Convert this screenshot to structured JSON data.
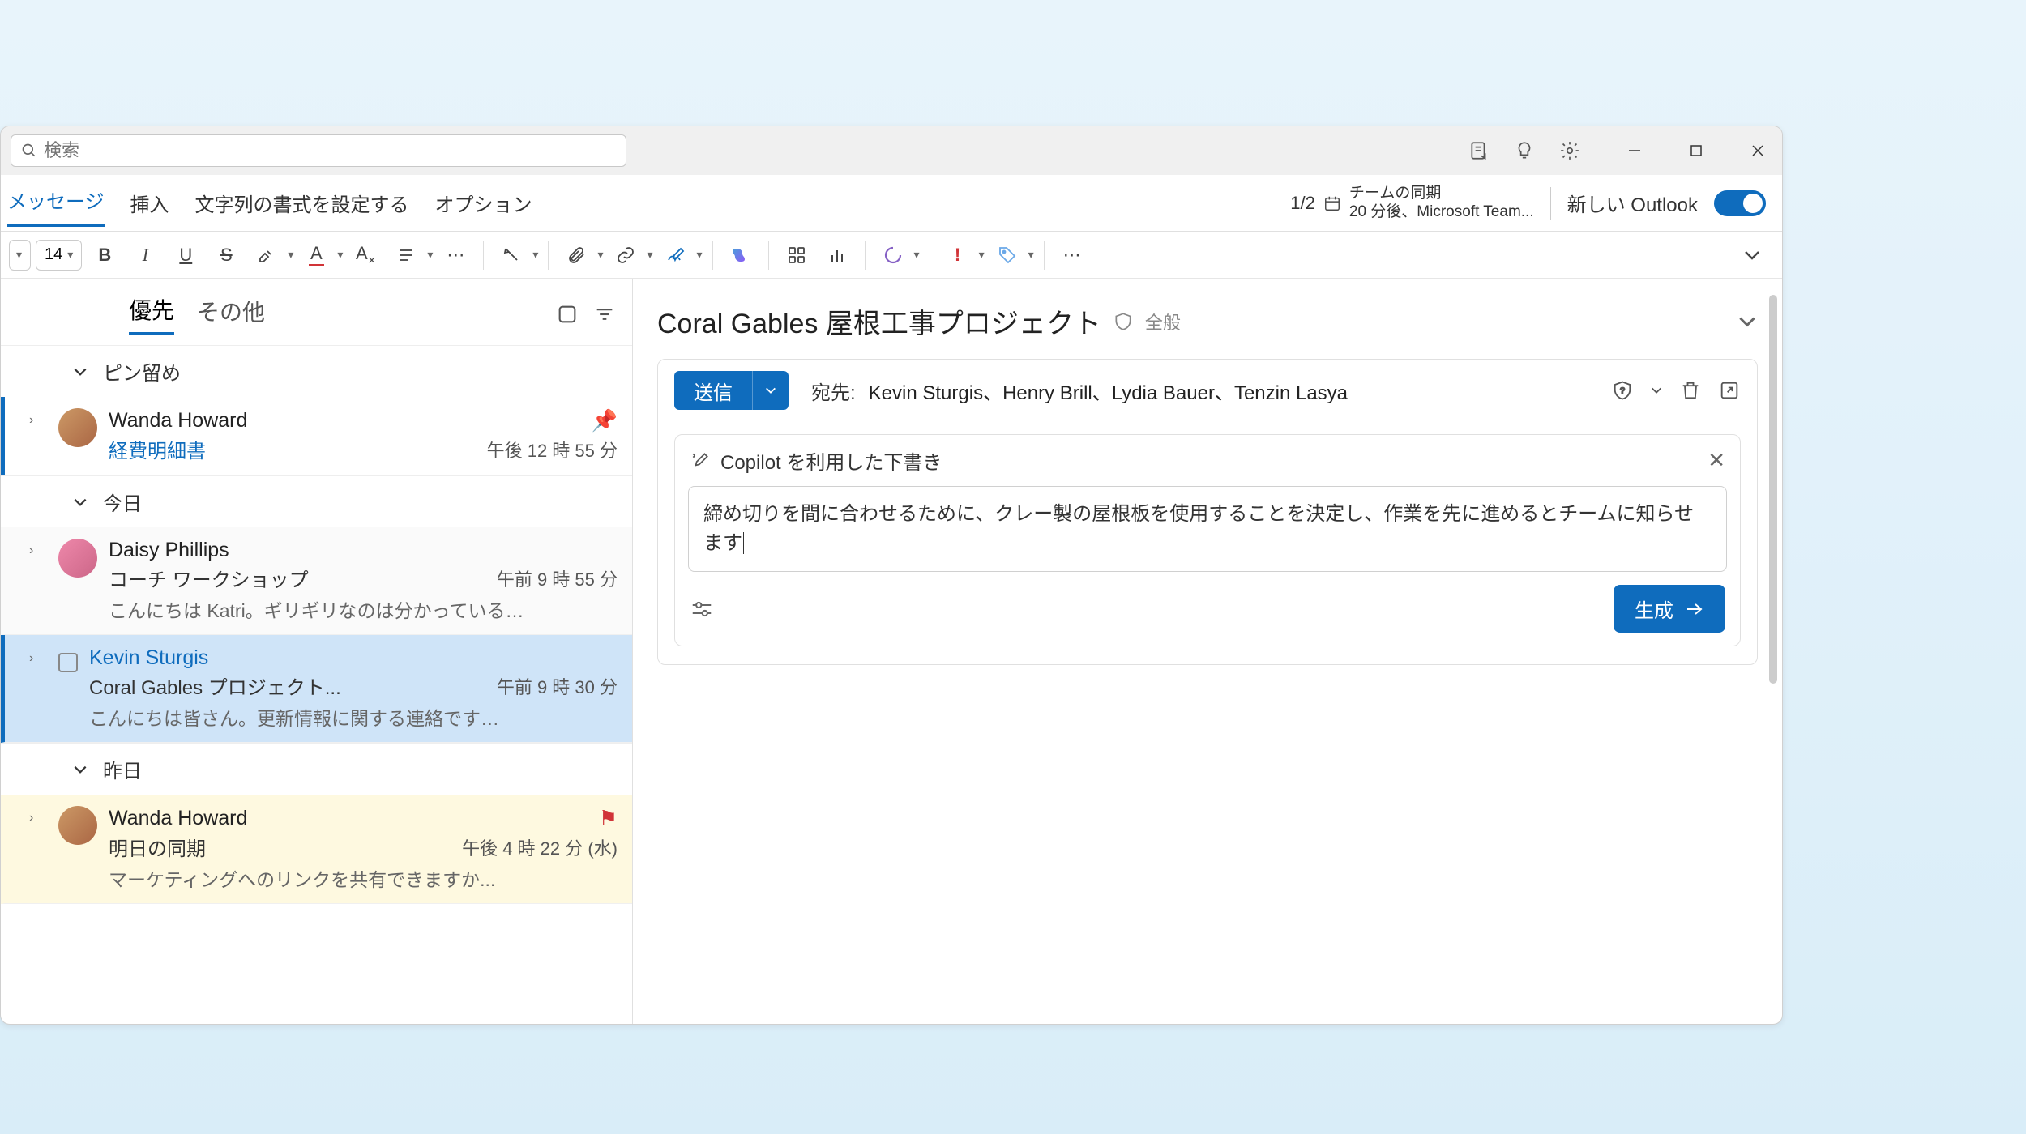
{
  "search": {
    "placeholder": "検索"
  },
  "titlebar_icons": [
    "notes",
    "tips",
    "settings"
  ],
  "ribbon": {
    "tabs": [
      "メッセージ",
      "挿入",
      "文字列の書式を設定する",
      "オプション"
    ],
    "meeting_count": "1/2",
    "sync_title": "チームの同期",
    "sync_detail": "20 分後、Microsoft Team...",
    "toggle_label": "新しい Outlook"
  },
  "toolbar": {
    "font_size": "14"
  },
  "list": {
    "tabs": [
      "優先",
      "その他"
    ],
    "sections": {
      "pinned": "ピン留め",
      "today": "今日",
      "yesterday": "昨日"
    },
    "items": [
      {
        "sender": "Wanda Howard",
        "subject": "経費明細書",
        "time": "午後 12 時 55 分",
        "preview": "",
        "pinned": true
      },
      {
        "sender": "Daisy Phillips",
        "subject": "コーチ ワークショップ",
        "time": "午前 9 時 55 分",
        "preview": "こんにちは Katri。ギリギリなのは分かっている…"
      },
      {
        "sender": "Kevin Sturgis",
        "subject": "Coral Gables プロジェクト...",
        "time": "午前 9 時 30 分",
        "preview": "こんにちは皆さん。更新情報に関する連絡です…",
        "selected": true
      },
      {
        "sender": "Wanda Howard",
        "subject": "明日の同期",
        "time": "午後 4 時 22 分 (水)",
        "preview": "マーケティングへのリンクを共有できますか...",
        "flagged": true
      }
    ]
  },
  "thread": {
    "subject": "Coral Gables 屋根工事プロジェクト",
    "classification": "全般"
  },
  "compose": {
    "send_label": "送信",
    "to_label": "宛先:",
    "to_list": "Kevin Sturgis、Henry Brill、Lydia Bauer、Tenzin Lasya"
  },
  "copilot": {
    "title": "Copilot を利用した下書き",
    "prompt": "締め切りを間に合わせるために、クレー製の屋根板を使用することを決定し、作業を先に進めるとチームに知らせます",
    "generate_label": "生成"
  }
}
